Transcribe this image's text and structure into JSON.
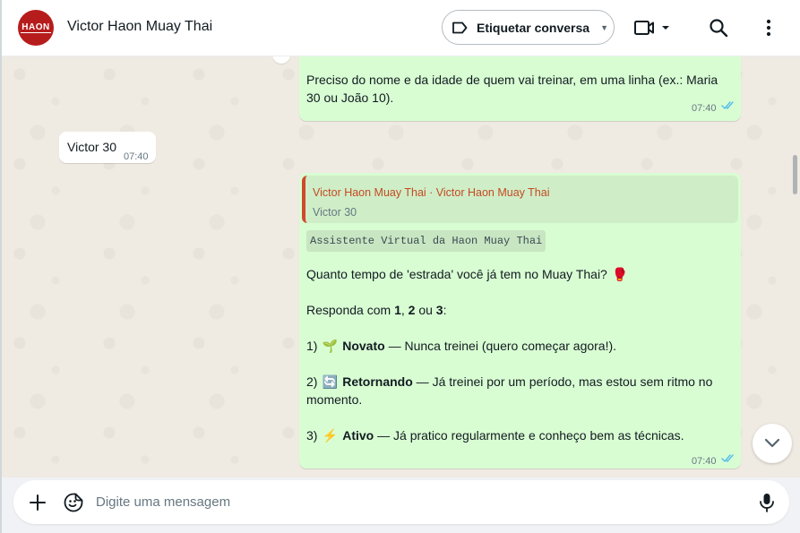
{
  "header": {
    "avatar_text": "HAON",
    "title": "Victor Haon Muay Thai",
    "label_button": "Etiquetar conversa"
  },
  "messages": {
    "m1": {
      "text": "Preciso do nome e da idade de quem vai treinar, em uma linha (ex.: Maria 30 ou João 10).",
      "time": "07:40"
    },
    "m2": {
      "text": "Victor 30",
      "time": "07:40"
    },
    "m3": {
      "quote_author": "Victor Haon Muay Thai · Victor Haon Muay Thai",
      "quote_text": "Victor 30",
      "mono": "Assistente Virtual da Haon Muay Thai",
      "question": "Quanto tempo de 'estrada' você já tem no Muay Thai?",
      "question_emoji": "🥊",
      "respond_prefix": "Responda com ",
      "respond_1": "1",
      "respond_sep1": ", ",
      "respond_2": "2",
      "respond_sep2": " ou ",
      "respond_3": "3",
      "respond_end": ":",
      "options": [
        {
          "num": "1)",
          "emoji": "🌱",
          "title": "Novato",
          "desc": " — Nunca treinei (quero começar agora!)."
        },
        {
          "num": "2)",
          "emoji": "🔄",
          "title": "Retornando",
          "desc": " — Já treinei por um período, mas estou sem ritmo no momento."
        },
        {
          "num": "3)",
          "emoji": "⚡",
          "title": "Ativo",
          "desc": " — Já pratico regularmente e conheço bem as técnicas."
        }
      ],
      "time": "07:40"
    }
  },
  "composer": {
    "placeholder": "Digite uma mensagem"
  },
  "colors": {
    "outgoing": "#d9fdd3",
    "incoming": "#ffffff",
    "wallpaper": "#efeae2",
    "read_ticks": "#53bdeb",
    "quote_accent": "#d0492d"
  }
}
